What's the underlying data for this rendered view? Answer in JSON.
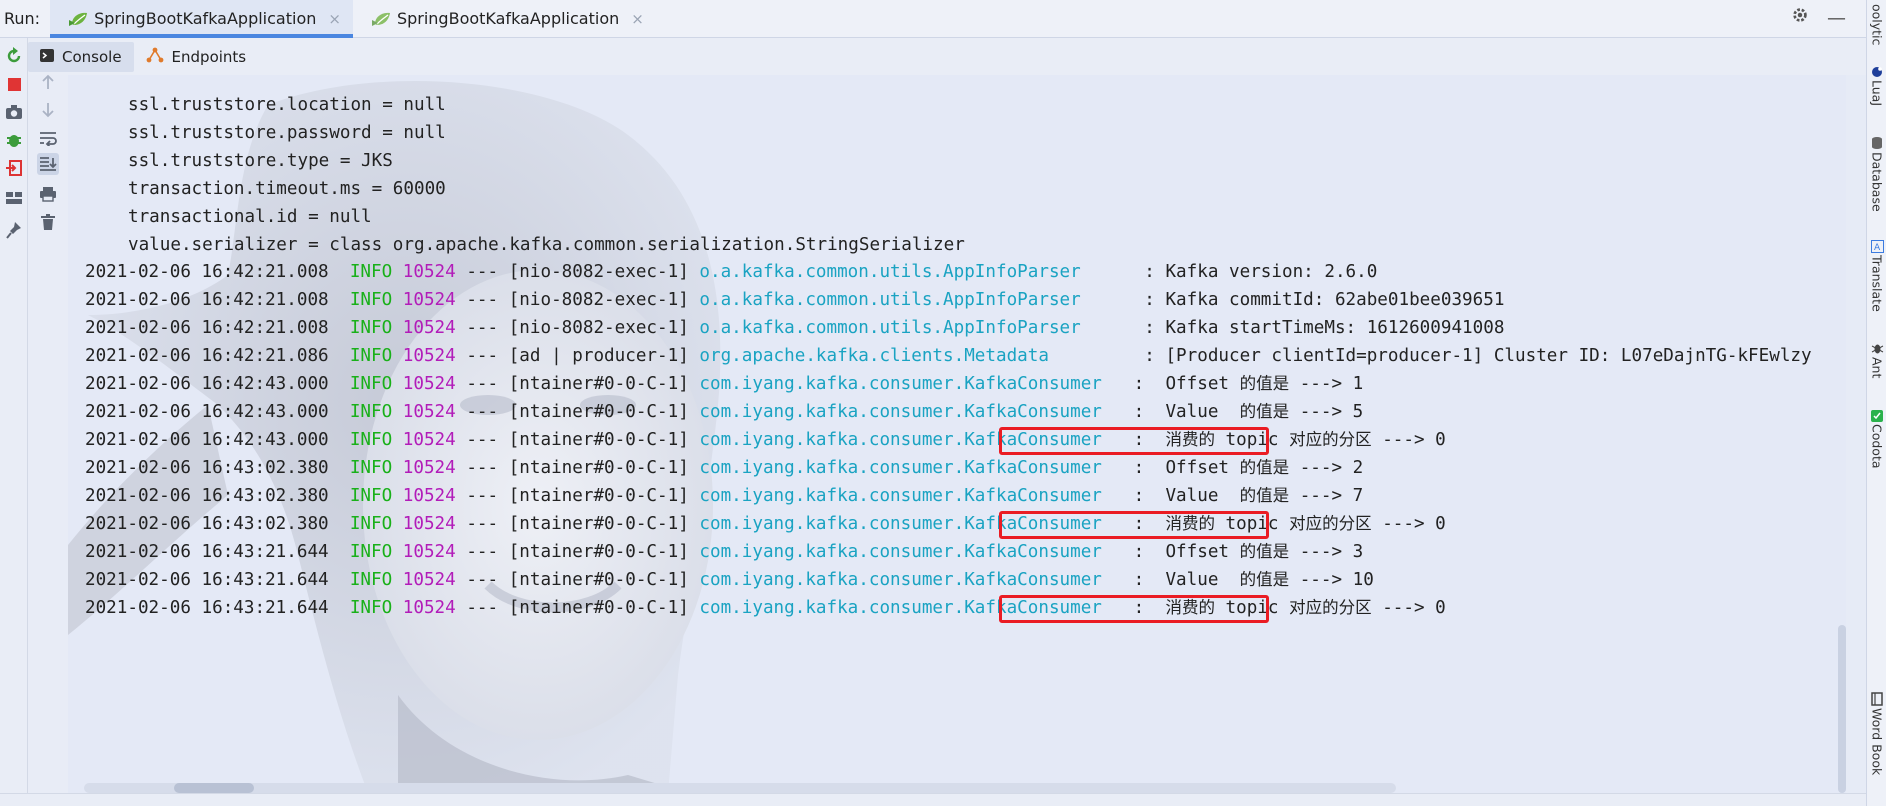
{
  "run": {
    "label": "Run:",
    "tabs": [
      {
        "label": "SpringBootKafkaApplication",
        "close": "×"
      },
      {
        "label": "SpringBootKafkaApplication",
        "close": "×"
      }
    ]
  },
  "window_controls": {
    "settings": "gear-icon",
    "minimize": "—"
  },
  "subtabs": [
    {
      "label": "Console",
      "icon": "console-icon"
    },
    {
      "label": "Endpoints",
      "icon": "endpoints-icon"
    }
  ],
  "config_lines": [
    "ssl.truststore.location = null",
    "ssl.truststore.password = null",
    "ssl.truststore.type = JKS",
    "transaction.timeout.ms = 60000",
    "transactional.id = null",
    "value.serializer = class org.apache.kafka.common.serialization.StringSerializer"
  ],
  "log_lines": [
    {
      "ts": "2021-02-06 16:42:21.008",
      "level": "INFO",
      "pid": "10524",
      "thread": "--- [nio-8082-exec-1]",
      "cls": "o.a.kafka.common.utils.AppInfoParser     ",
      "msg": " : Kafka version: 2.6.0"
    },
    {
      "ts": "2021-02-06 16:42:21.008",
      "level": "INFO",
      "pid": "10524",
      "thread": "--- [nio-8082-exec-1]",
      "cls": "o.a.kafka.common.utils.AppInfoParser     ",
      "msg": " : Kafka commitId: 62abe01bee039651"
    },
    {
      "ts": "2021-02-06 16:42:21.008",
      "level": "INFO",
      "pid": "10524",
      "thread": "--- [nio-8082-exec-1]",
      "cls": "o.a.kafka.common.utils.AppInfoParser     ",
      "msg": " : Kafka startTimeMs: 1612600941008"
    },
    {
      "ts": "2021-02-06 16:42:21.086",
      "level": "INFO",
      "pid": "10524",
      "thread": "--- [ad | producer-1]",
      "cls": "org.apache.kafka.clients.Metadata        ",
      "msg": " : [Producer clientId=producer-1] Cluster ID: L07eDajnTG-kFEwlzy"
    },
    {
      "ts": "2021-02-06 16:42:43.000",
      "level": "INFO",
      "pid": "10524",
      "thread": "--- [ntainer#0-0-C-1]",
      "cls": "com.iyang.kafka.consumer.KafkaConsumer  ",
      "msg_pre": " :  Offset ",
      "msg_cjk": "的值是",
      "msg_post": " ---> 1"
    },
    {
      "ts": "2021-02-06 16:42:43.000",
      "level": "INFO",
      "pid": "10524",
      "thread": "--- [ntainer#0-0-C-1]",
      "cls": "com.iyang.kafka.consumer.KafkaConsumer  ",
      "msg_pre": " :  Value  ",
      "msg_cjk": "的值是",
      "msg_post": " ---> 5"
    },
    {
      "ts": "2021-02-06 16:42:43.000",
      "level": "INFO",
      "pid": "10524",
      "thread": "--- [ntainer#0-0-C-1]",
      "cls": "com.iyang.kafka.consumer.KafkaConsumer  ",
      "msg_pre": " :  ",
      "msg_cjk": "消费的",
      "msg_mid": " topic ",
      "msg_cjk2": "对应的分区",
      "msg_post": " ---> 0",
      "highlighted": true
    },
    {
      "ts": "2021-02-06 16:43:02.380",
      "level": "INFO",
      "pid": "10524",
      "thread": "--- [ntainer#0-0-C-1]",
      "cls": "com.iyang.kafka.consumer.KafkaConsumer  ",
      "msg_pre": " :  Offset ",
      "msg_cjk": "的值是",
      "msg_post": " ---> 2"
    },
    {
      "ts": "2021-02-06 16:43:02.380",
      "level": "INFO",
      "pid": "10524",
      "thread": "--- [ntainer#0-0-C-1]",
      "cls": "com.iyang.kafka.consumer.KafkaConsumer  ",
      "msg_pre": " :  Value  ",
      "msg_cjk": "的值是",
      "msg_post": " ---> 7"
    },
    {
      "ts": "2021-02-06 16:43:02.380",
      "level": "INFO",
      "pid": "10524",
      "thread": "--- [ntainer#0-0-C-1]",
      "cls": "com.iyang.kafka.consumer.KafkaConsumer  ",
      "msg_pre": " :  ",
      "msg_cjk": "消费的",
      "msg_mid": " topic ",
      "msg_cjk2": "对应的分区",
      "msg_post": " ---> 0",
      "highlighted": true
    },
    {
      "ts": "2021-02-06 16:43:21.644",
      "level": "INFO",
      "pid": "10524",
      "thread": "--- [ntainer#0-0-C-1]",
      "cls": "com.iyang.kafka.consumer.KafkaConsumer  ",
      "msg_pre": " :  Offset ",
      "msg_cjk": "的值是",
      "msg_post": " ---> 3"
    },
    {
      "ts": "2021-02-06 16:43:21.644",
      "level": "INFO",
      "pid": "10524",
      "thread": "--- [ntainer#0-0-C-1]",
      "cls": "com.iyang.kafka.consumer.KafkaConsumer  ",
      "msg_pre": " :  Value  ",
      "msg_cjk": "的值是",
      "msg_post": " ---> 10"
    },
    {
      "ts": "2021-02-06 16:43:21.644",
      "level": "INFO",
      "pid": "10524",
      "thread": "--- [ntainer#0-0-C-1]",
      "cls": "com.iyang.kafka.consumer.KafkaConsumer  ",
      "msg_pre": " :  ",
      "msg_cjk": "消费的",
      "msg_mid": " topic ",
      "msg_cjk2": "对应的分区",
      "msg_post": " ---> 0",
      "highlighted": true
    }
  ],
  "right_sidebar": [
    {
      "label": "oolytic",
      "icon": ""
    },
    {
      "label": "LuaJ",
      "icon": "lua-icon"
    },
    {
      "label": "Database",
      "icon": "database-icon"
    },
    {
      "label": "Translate",
      "icon": "translate-icon"
    },
    {
      "label": "Ant",
      "icon": "ant-icon"
    },
    {
      "label": "Codota",
      "icon": "codota-icon"
    },
    {
      "label": "Word Book",
      "icon": "wordbook-icon"
    }
  ],
  "colors": {
    "info": "#19b019",
    "pid": "#b21cb9",
    "logger": "#1aa3c2",
    "highlight_box": "#ea1c24",
    "accent": "#4a86e0"
  }
}
